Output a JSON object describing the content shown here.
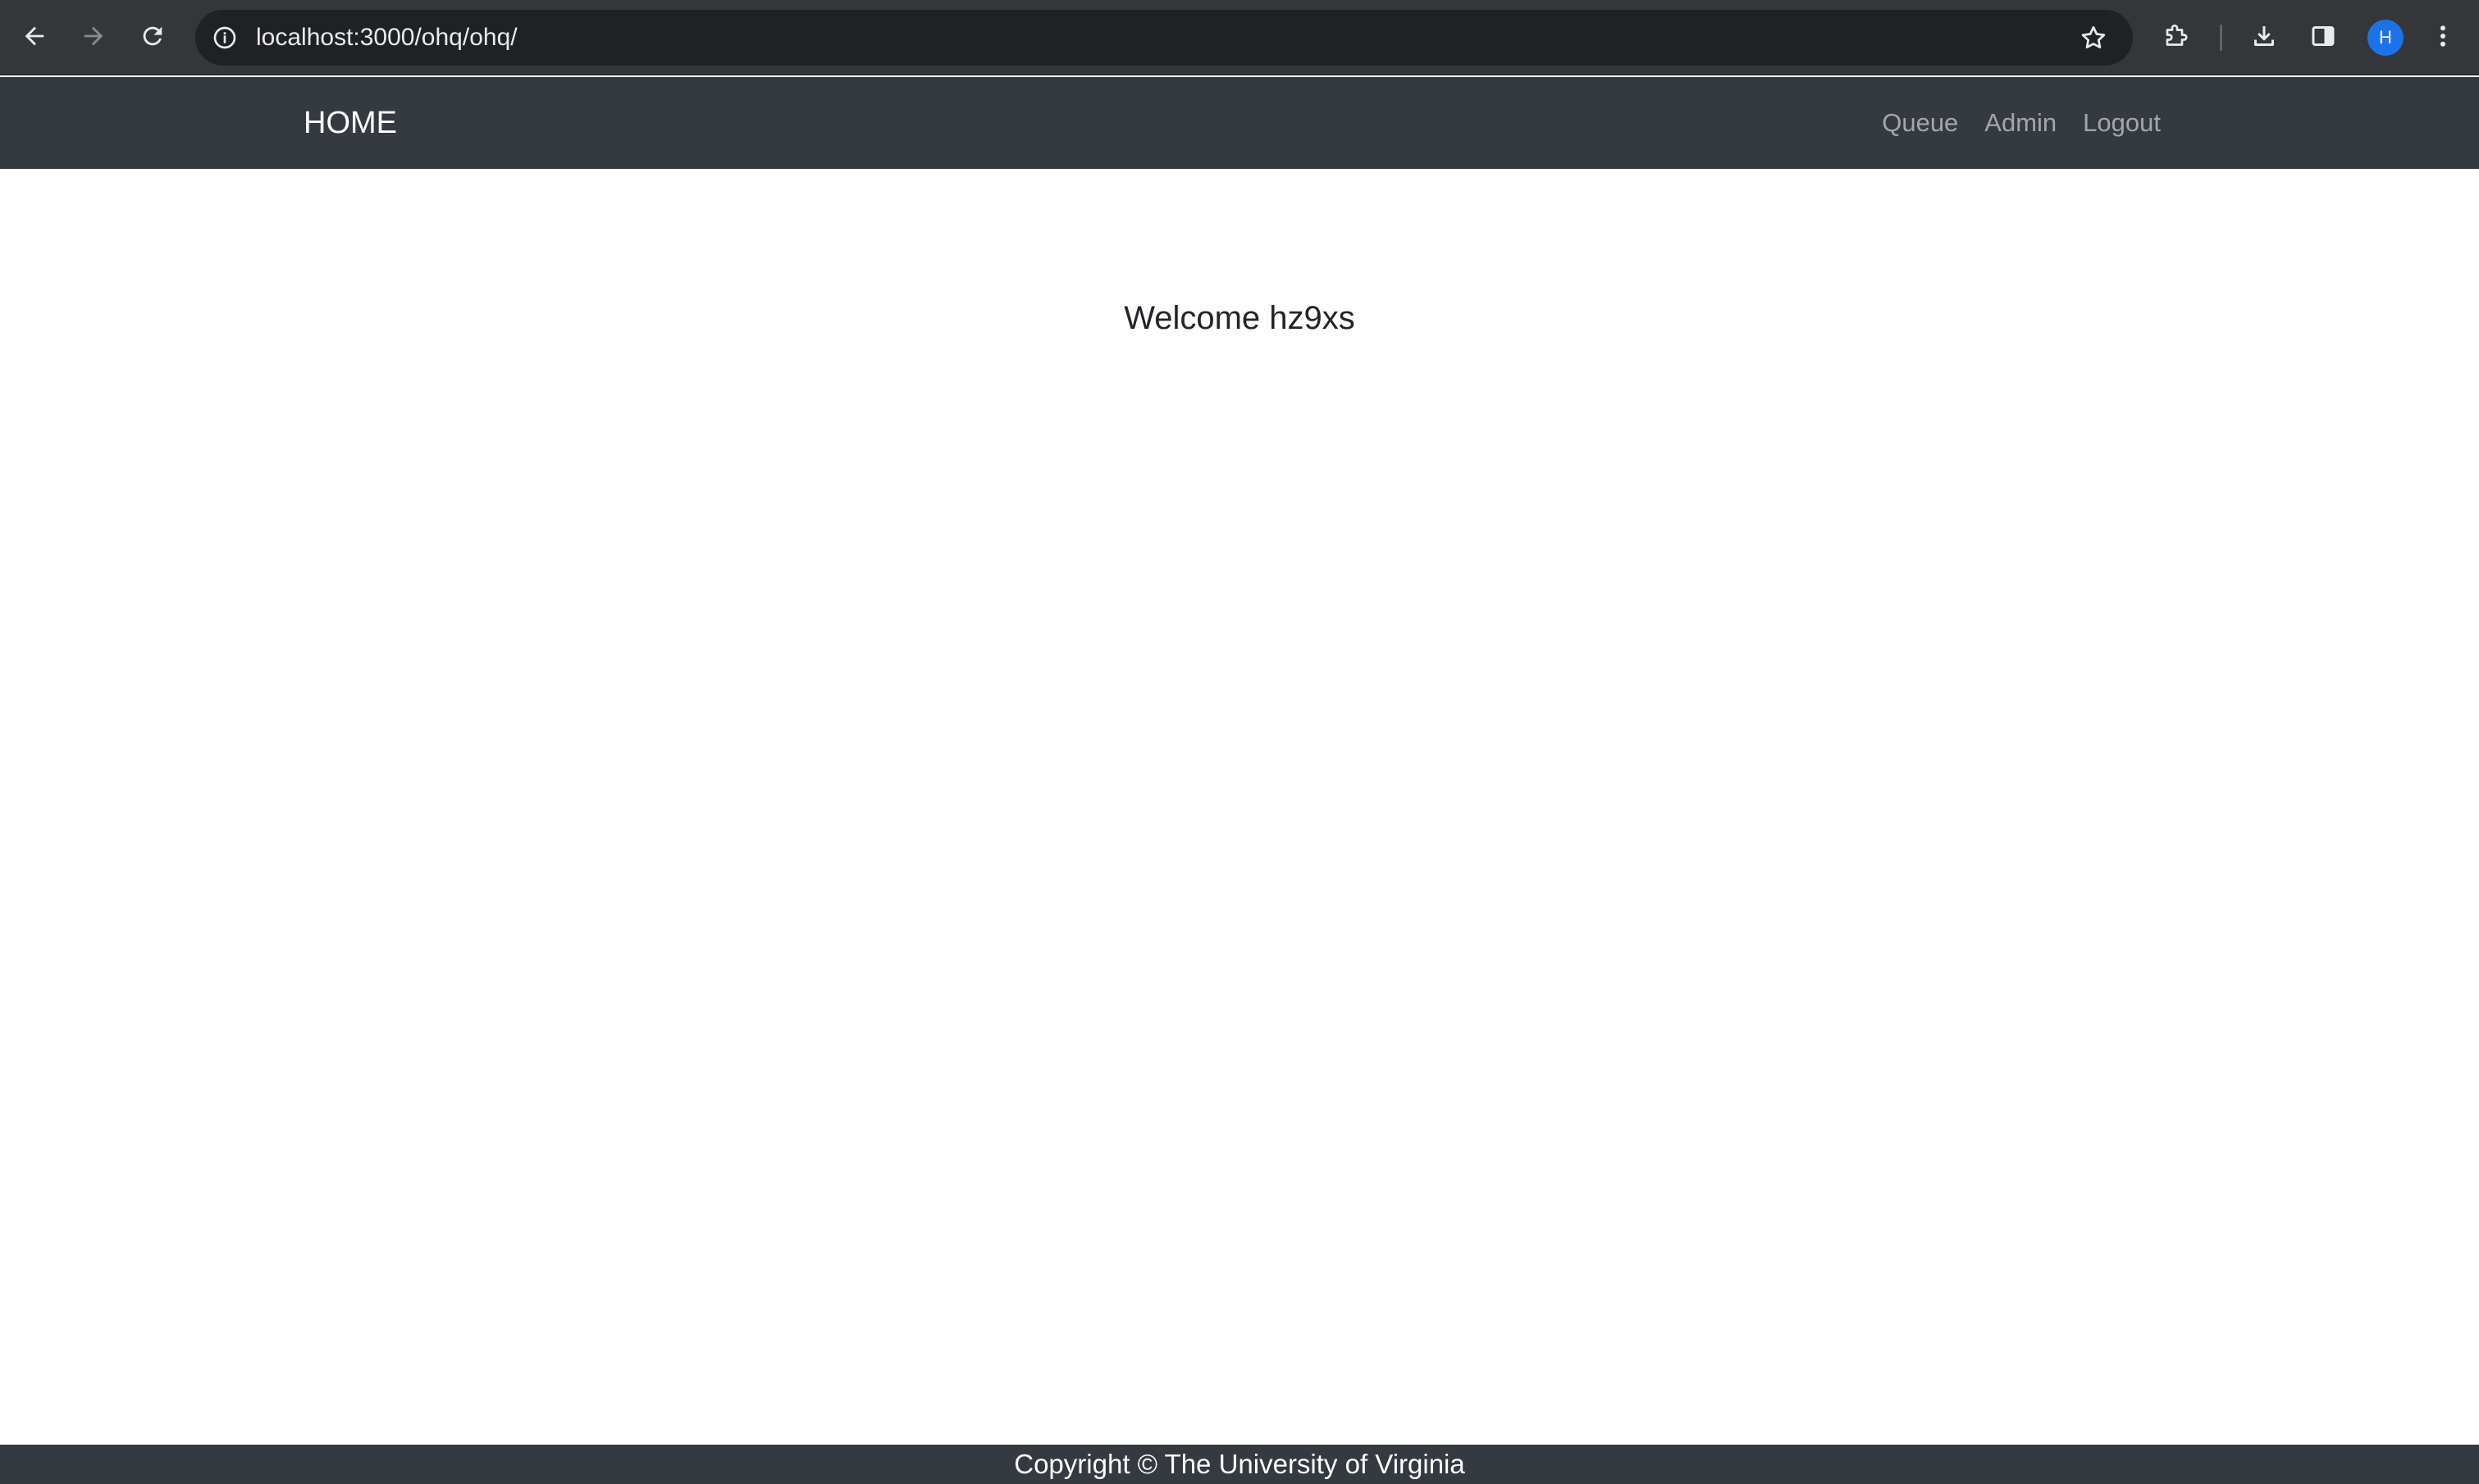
{
  "browser": {
    "url": "localhost:3000/ohq/ohq/",
    "profile_initial": "H",
    "icons": {
      "back": "arrow-left-icon",
      "forward": "arrow-right-icon",
      "reload": "reload-icon",
      "site_info": "info-icon",
      "bookmark": "star-icon",
      "extensions": "puzzle-icon",
      "downloads": "download-icon",
      "side_panel": "side-panel-icon",
      "menu": "kebab-menu-icon"
    },
    "colors": {
      "toolbar": "#35363a",
      "omnibox": "#202124",
      "avatar": "#1a73e8"
    }
  },
  "navbar": {
    "brand": "HOME",
    "links": [
      {
        "label": "Queue"
      },
      {
        "label": "Admin"
      },
      {
        "label": "Logout"
      }
    ],
    "background": "#343a40"
  },
  "main": {
    "welcome": "Welcome hz9xs"
  },
  "footer": {
    "text": "Copyright © The University of Virginia",
    "background": "#343a40"
  }
}
